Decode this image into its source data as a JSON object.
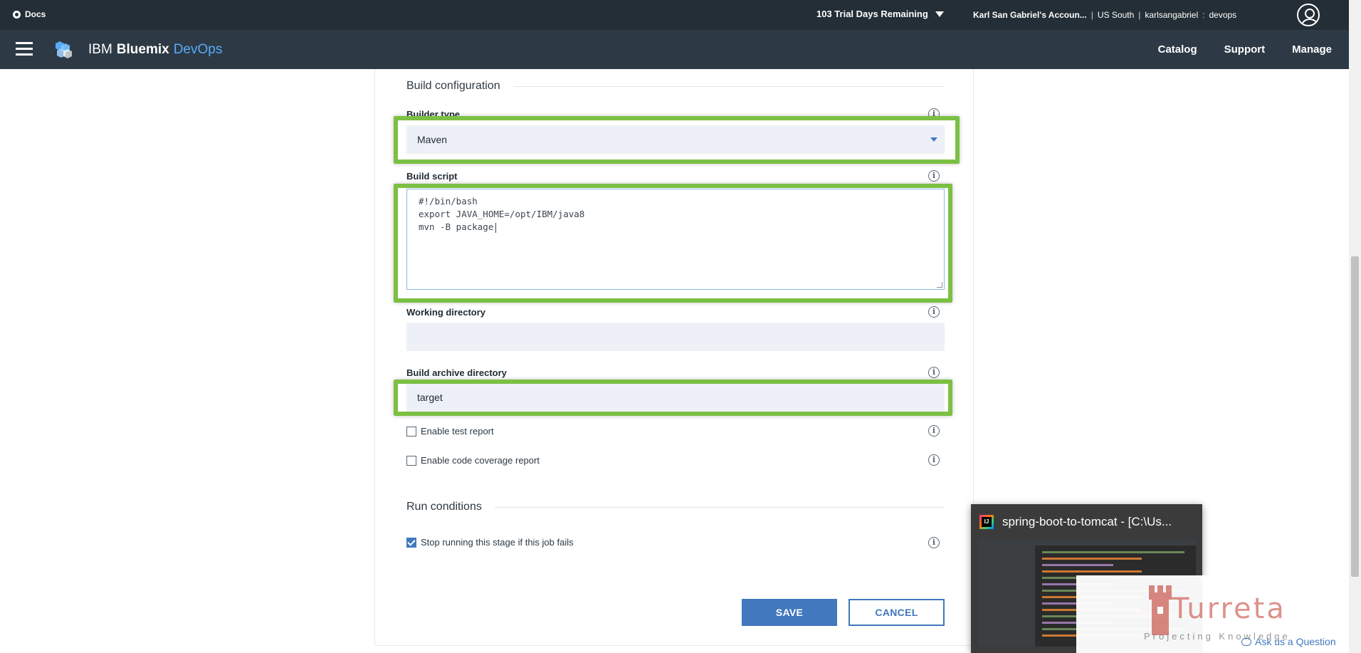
{
  "topbar": {
    "docs_label": "Docs",
    "trial_text": "103 Trial Days Remaining",
    "account_name": "Karl San Gabriel's Accoun...",
    "region": "US South",
    "org": "karlsangabriel",
    "space": "devops",
    "separator": "|",
    "colon": ":"
  },
  "nav": {
    "brand_ibm": "IBM",
    "brand_bluemix": "Bluemix",
    "brand_devops": "DevOps",
    "links": [
      "Catalog",
      "Support",
      "Manage"
    ]
  },
  "build_config": {
    "section_title": "Build configuration",
    "builder_type_label": "Builder type",
    "builder_type_value": "Maven",
    "build_script_label": "Build script",
    "build_script_value": "#!/bin/bash\nexport JAVA_HOME=/opt/IBM/java8\nmvn -B package",
    "working_dir_label": "Working directory",
    "working_dir_value": "",
    "archive_dir_label": "Build archive directory",
    "archive_dir_value": "target",
    "enable_test_report_label": "Enable test report",
    "enable_test_report_checked": false,
    "enable_coverage_label": "Enable code coverage report",
    "enable_coverage_checked": false,
    "info_glyph": "i"
  },
  "run_conditions": {
    "section_title": "Run conditions",
    "stop_on_fail_label": "Stop running this stage if this job fails",
    "stop_on_fail_checked": true
  },
  "actions": {
    "save_label": "SAVE",
    "cancel_label": "CANCEL"
  },
  "preview": {
    "title": "spring-boot-to-tomcat - [C:\\Us..."
  },
  "watermark": {
    "name": "Turreta",
    "tagline": "Projecting Knowledge"
  },
  "ask_question": "Ask us a Question",
  "colors": {
    "topbar_bg": "#232e36",
    "nav_bg": "#2d3a45",
    "accent_blue": "#4178be",
    "devops_blue": "#5aaafa",
    "highlight_green": "#7bc043",
    "field_bg": "#edf1f7"
  }
}
